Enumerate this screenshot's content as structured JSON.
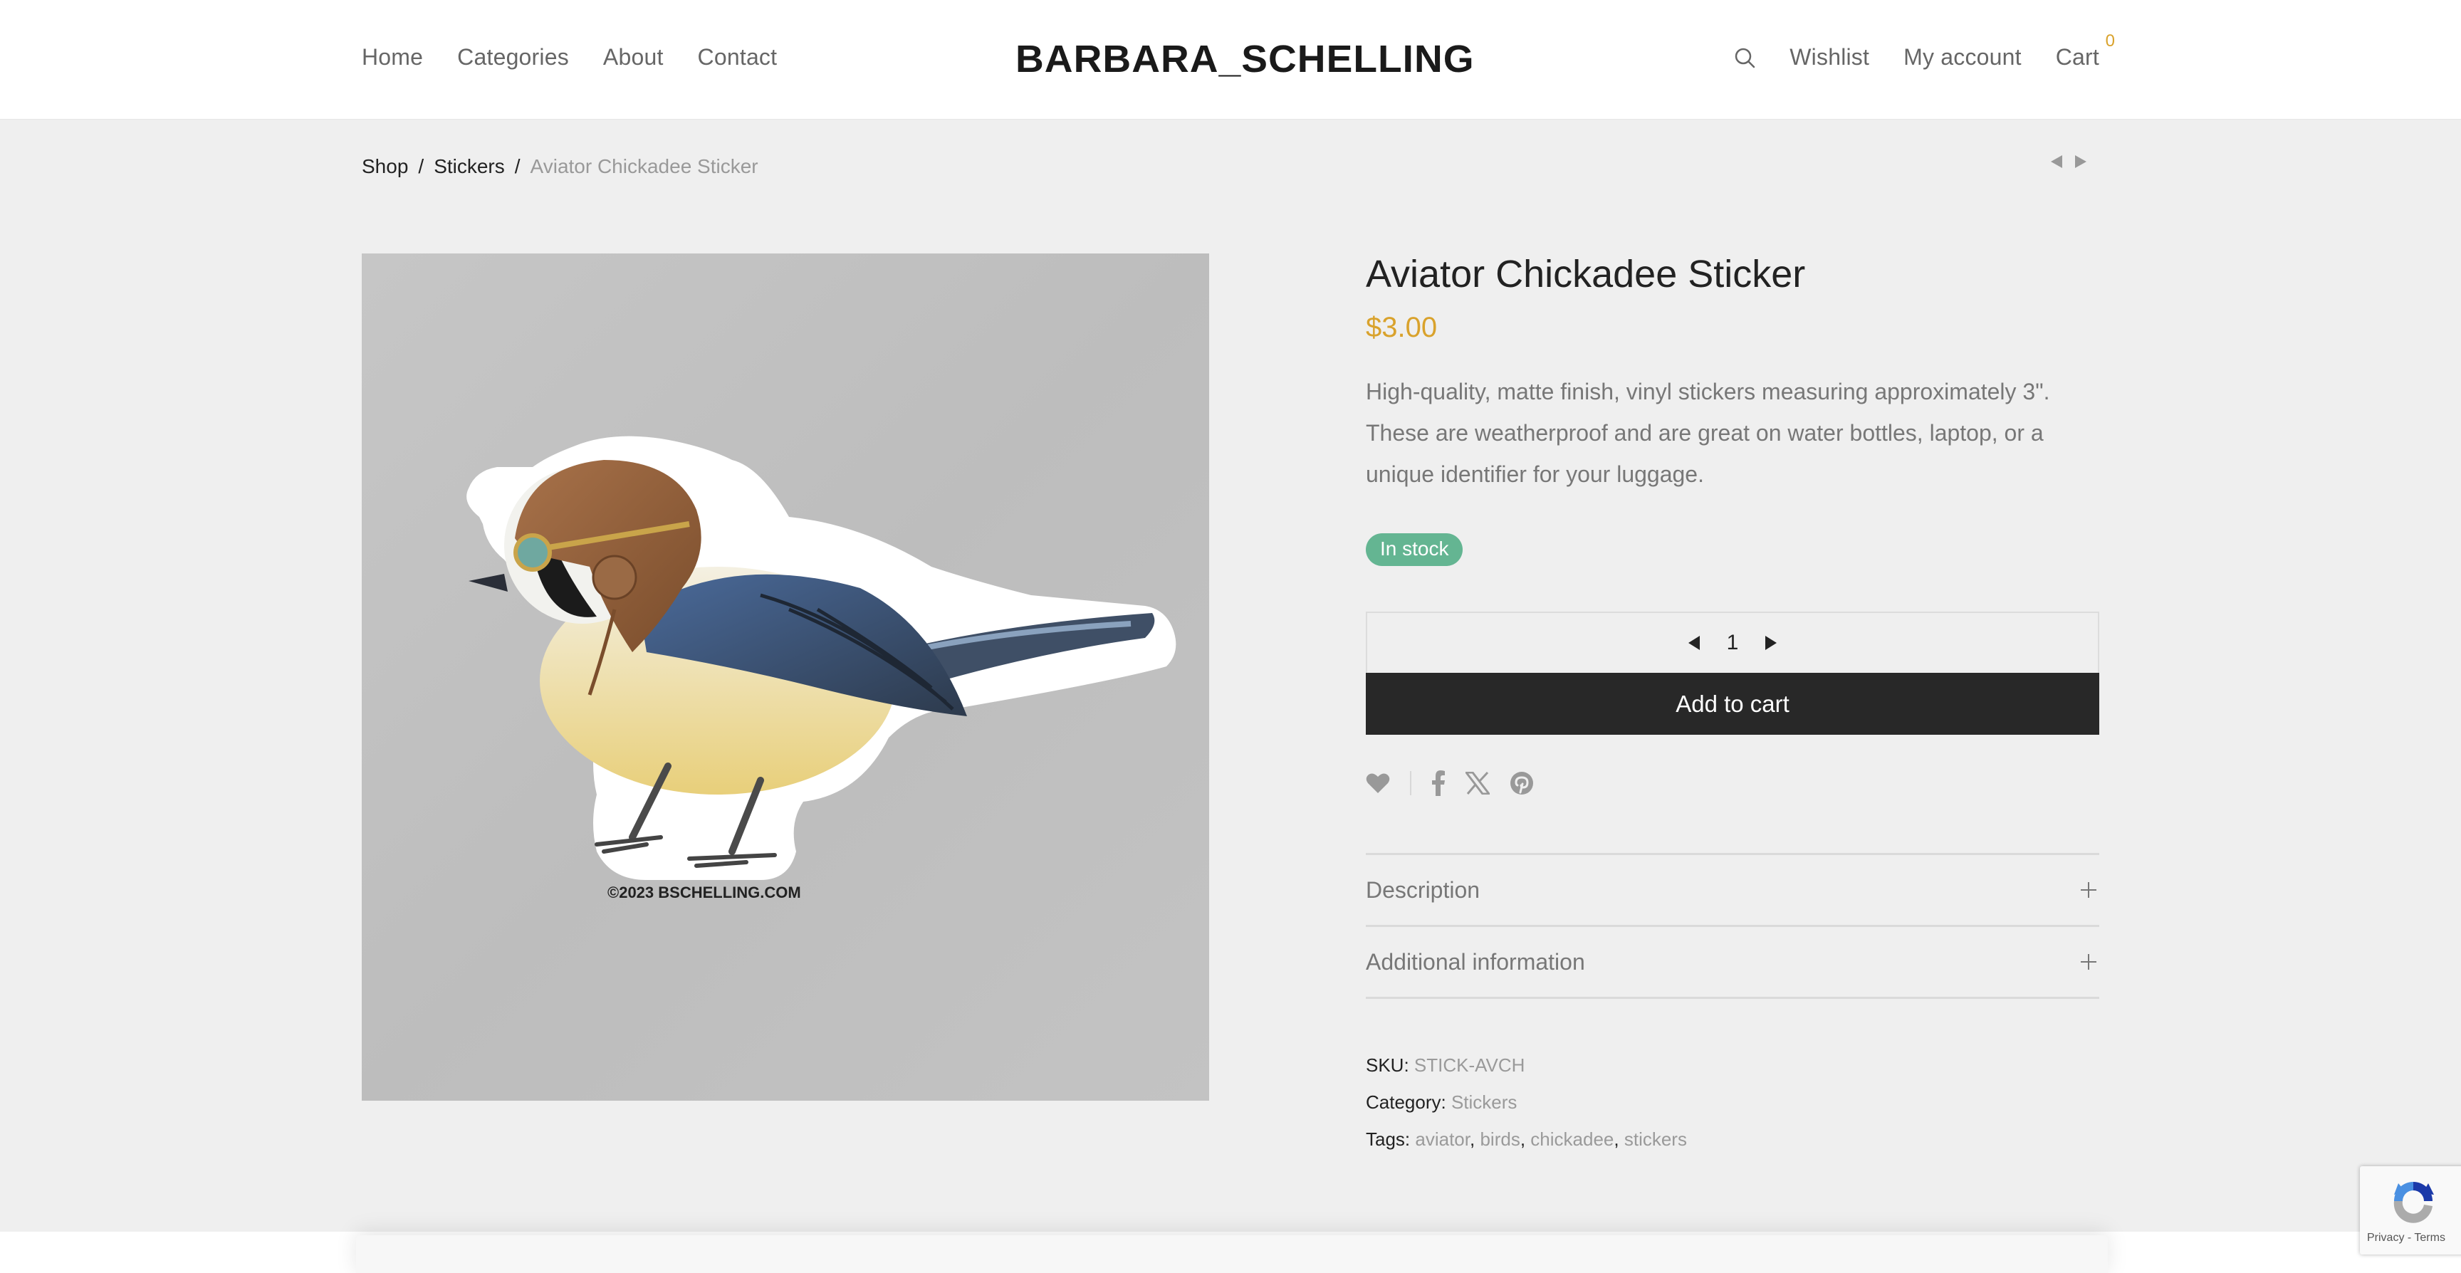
{
  "header": {
    "nav_left": [
      "Home",
      "Categories",
      "About",
      "Contact"
    ],
    "logo": "BARBARA_SCHELLING",
    "nav_right": {
      "search_icon": "search-icon",
      "wishlist": "Wishlist",
      "account": "My account",
      "cart": "Cart",
      "cart_count": "0"
    }
  },
  "breadcrumb": {
    "items": [
      "Shop",
      "Stickers"
    ],
    "separator": "/",
    "current": "Aviator Chickadee Sticker",
    "prev_icon": "triangle-left-icon",
    "next_icon": "triangle-right-icon"
  },
  "product": {
    "image_alt": "Aviator chickadee sticker illustration",
    "image_caption": "©2023  BSCHELLING.COM",
    "title": "Aviator Chickadee Sticker",
    "price": "$3.00",
    "description": "High-quality, matte finish, vinyl stickers measuring approximately 3\". These are weatherproof and are great on water bottles, laptop, or a unique identifier for your luggage.",
    "stock": "In stock",
    "quantity": "1",
    "add_to_cart": "Add to cart",
    "share_icons": [
      "heart-icon",
      "facebook-icon",
      "x-icon",
      "pinterest-icon"
    ],
    "accordion": [
      "Description",
      "Additional information"
    ],
    "meta": {
      "sku_label": "SKU:",
      "sku": "STICK-AVCH",
      "category_label": "Category:",
      "category": "Stickers",
      "tags_label": "Tags:",
      "tags": [
        "aviator",
        "birds",
        "chickadee",
        "stickers"
      ]
    }
  },
  "recaptcha": {
    "links": "Privacy - Terms"
  },
  "colors": {
    "accent": "#d9a22c",
    "stock_badge": "#64b592",
    "button": "#282828",
    "background": "#efefef"
  }
}
